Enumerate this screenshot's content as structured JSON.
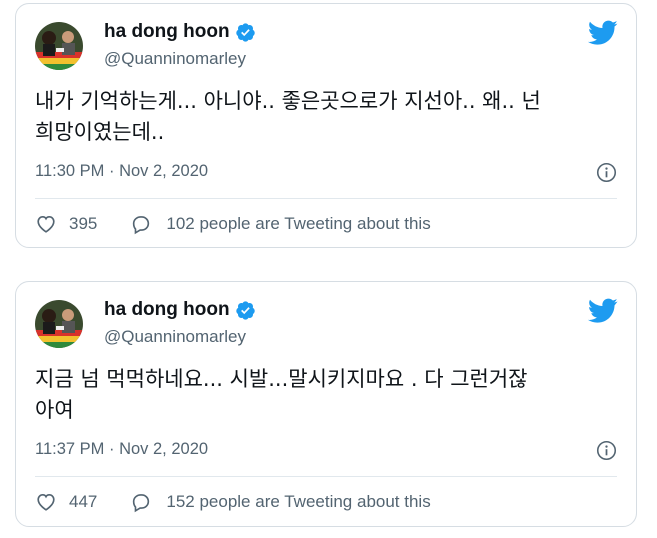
{
  "tweets": [
    {
      "author": {
        "display_name": "ha dong hoon",
        "handle": "@Quanninomarley",
        "verified": true
      },
      "text": "내가 기억하는게... 아니야.. 좋은곳으로가 지선아.. 왜.. 넌\n희망이였는데..",
      "timestamp": "11:30 PM · Nov 2, 2020",
      "likes": "395",
      "discussion": "102 people are Tweeting about this"
    },
    {
      "author": {
        "display_name": "ha dong hoon",
        "handle": "@Quanninomarley",
        "verified": true
      },
      "text": "지금 넘 먹먹하네요... 시발...말시키지마요 . 다 그런거잖\n아여",
      "timestamp": "11:37 PM · Nov 2, 2020",
      "likes": "447",
      "discussion": "152 people are Tweeting about this"
    }
  ],
  "colors": {
    "twitter_blue": "#1d9bf0",
    "secondary_text": "#536471",
    "border": "#d6dde3"
  },
  "icons": [
    "avatar",
    "verified-badge-icon",
    "twitter-bird-icon",
    "info-icon",
    "heart-icon",
    "speech-bubble-icon"
  ]
}
